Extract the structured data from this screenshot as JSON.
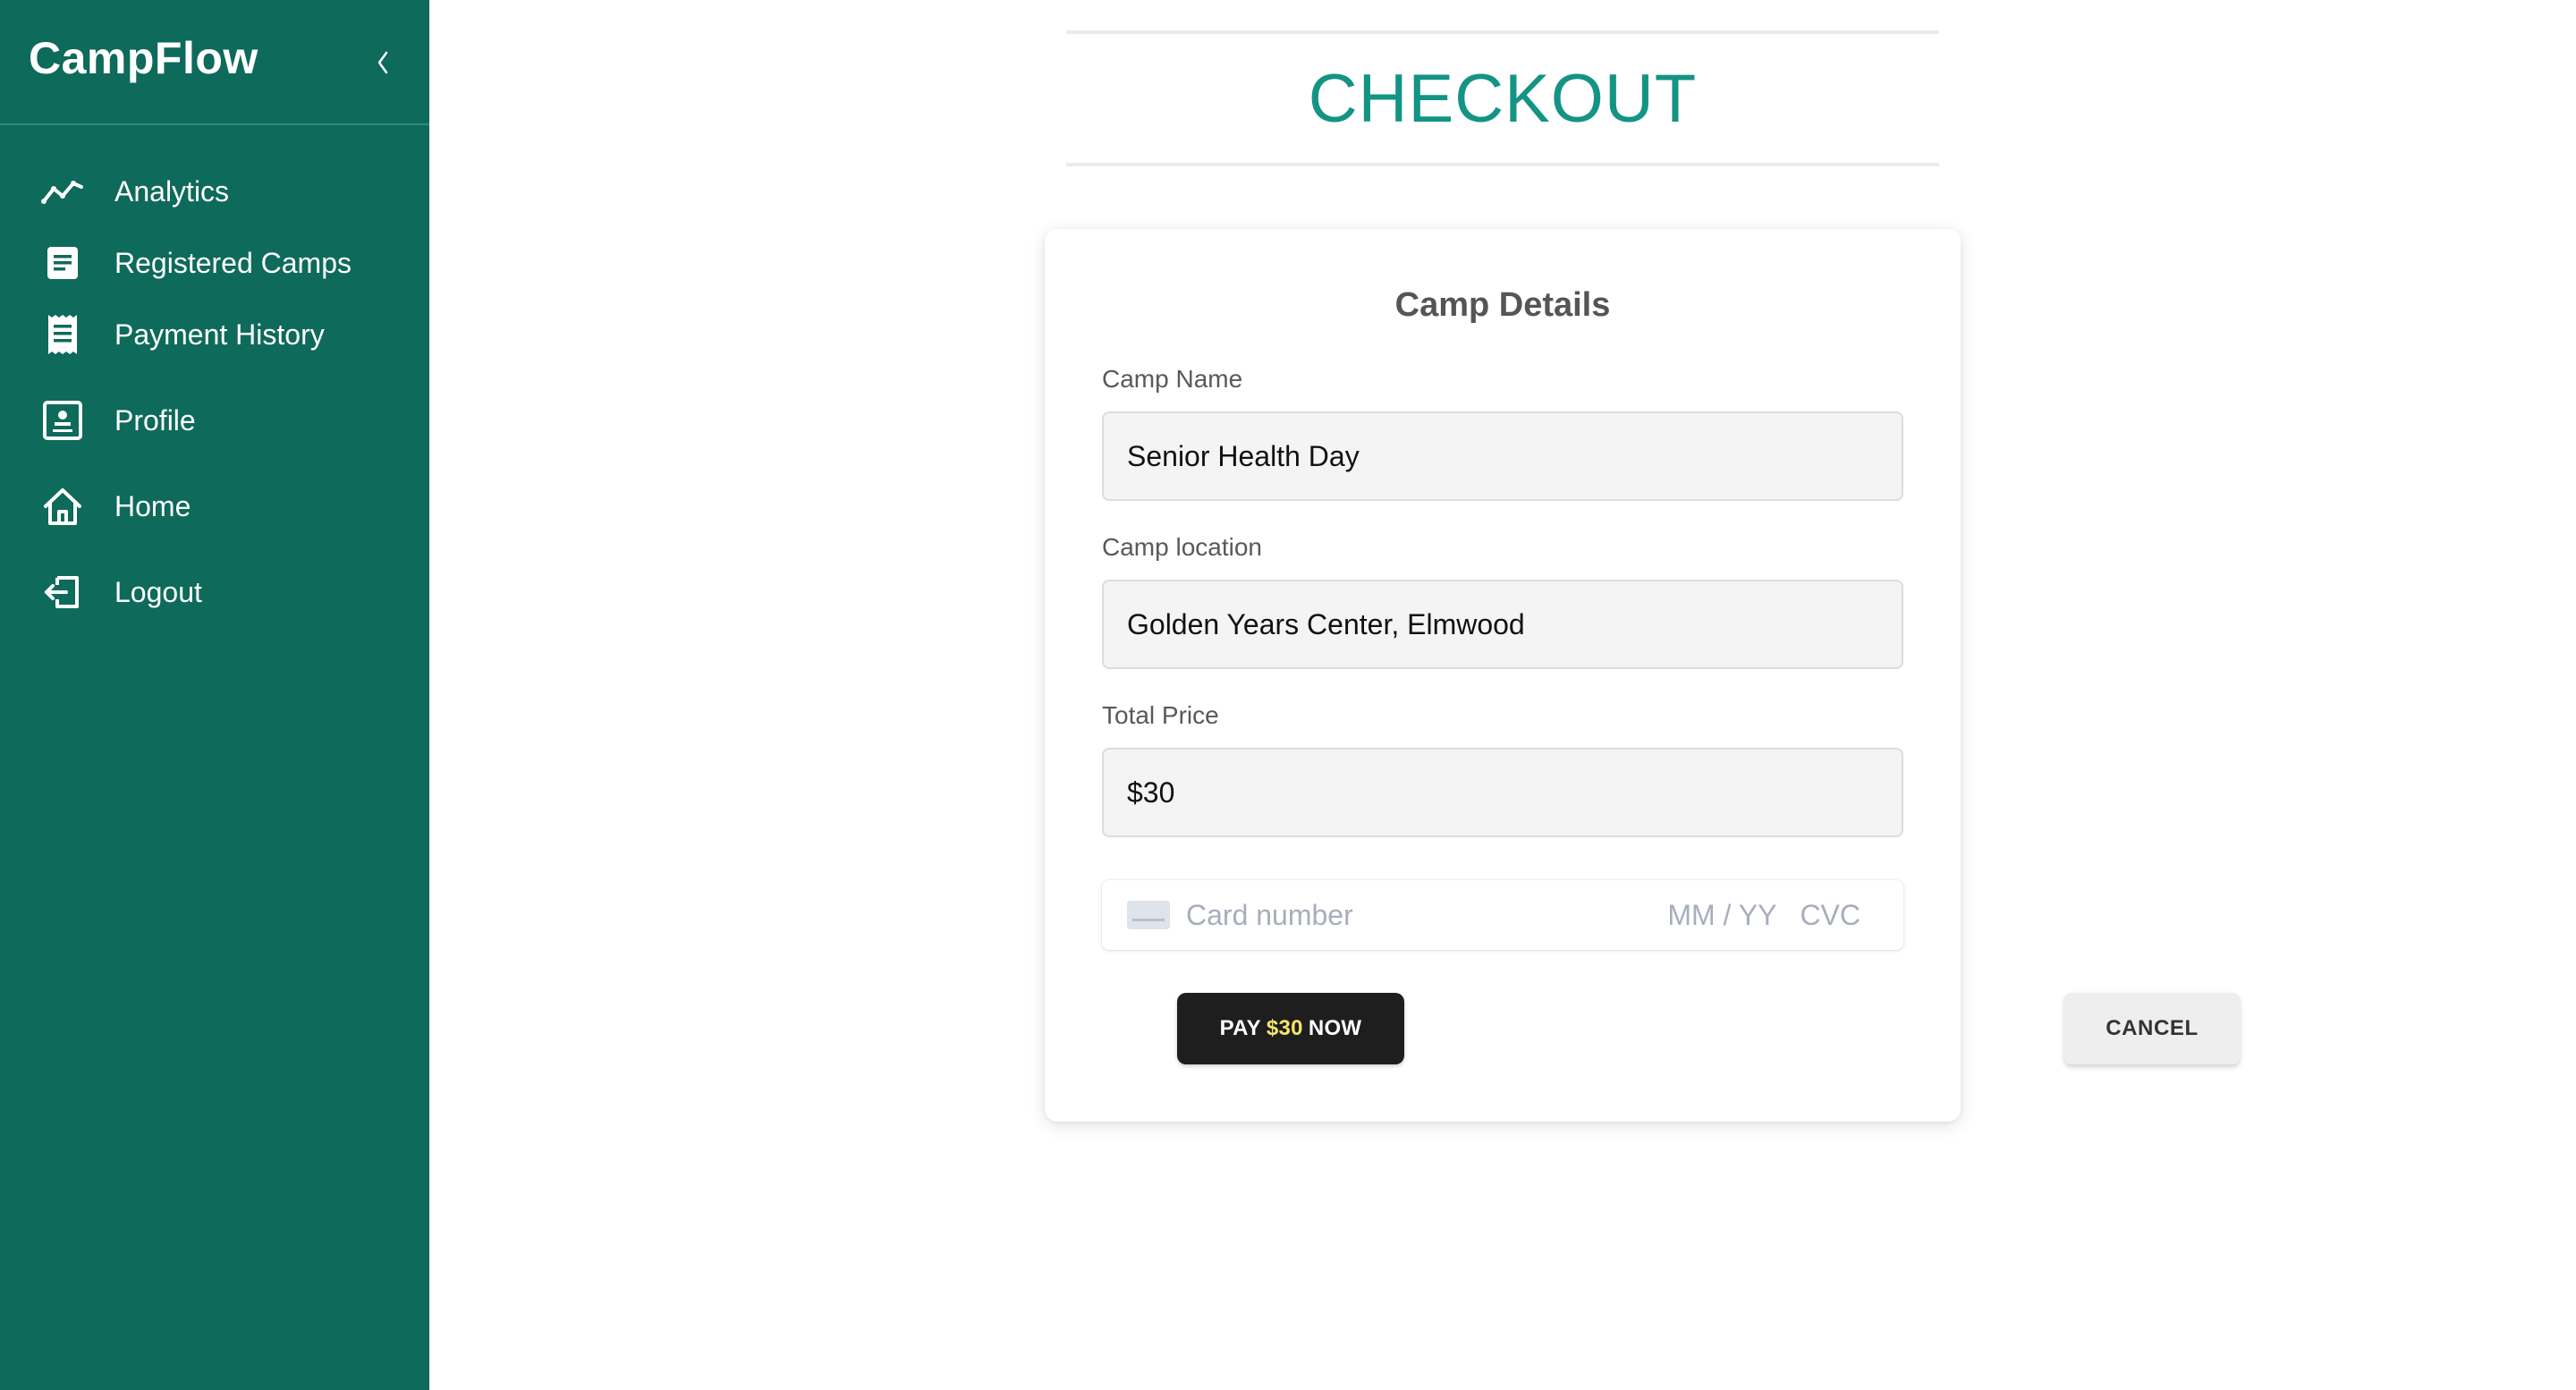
{
  "sidebar": {
    "brand": "CampFlow",
    "collapse_icon": "chevron-left-icon",
    "items": [
      {
        "label": "Analytics",
        "icon": "trending-line-icon"
      },
      {
        "label": "Registered Camps",
        "icon": "document-icon"
      },
      {
        "label": "Payment History",
        "icon": "receipt-icon"
      },
      {
        "label": "Profile",
        "icon": "profile-card-icon"
      },
      {
        "label": "Home",
        "icon": "home-icon"
      },
      {
        "label": "Logout",
        "icon": "logout-icon"
      }
    ]
  },
  "page": {
    "title": "CHECKOUT"
  },
  "checkout": {
    "section_title": "Camp Details",
    "fields": {
      "camp_name": {
        "label": "Camp Name",
        "value": "Senior Health Day"
      },
      "camp_location": {
        "label": "Camp location",
        "value": "Golden Years Center, Elmwood"
      },
      "total_price": {
        "label": "Total Price",
        "value": "$30"
      }
    },
    "card_element": {
      "icon": "credit-card-icon",
      "number_placeholder": "Card number",
      "expiry_placeholder": "MM / YY",
      "cvc_placeholder": "CVC"
    },
    "pay_button": {
      "prefix": "PAY",
      "amount": "$30",
      "suffix": "NOW"
    },
    "cancel_button": {
      "label": "CANCEL"
    }
  },
  "colors": {
    "sidebar_bg": "#0e6a5a",
    "title_accent": "#139484",
    "pay_amount_highlight": "#f5e46b",
    "pay_button_bg": "#1e1e1e"
  }
}
